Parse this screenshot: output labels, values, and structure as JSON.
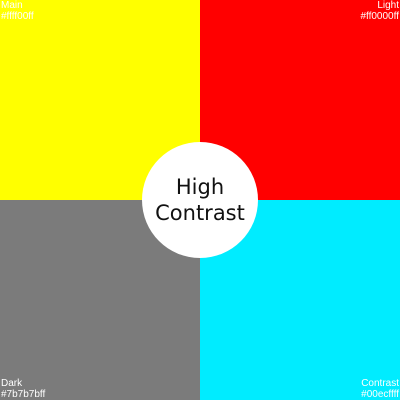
{
  "swatches": {
    "main": {
      "name": "Main",
      "code": "#ffff00ff",
      "color": "#ffff00"
    },
    "light": {
      "name": "Light",
      "code": "#ff0000ff",
      "color": "#ff0000"
    },
    "dark": {
      "name": "Dark",
      "code": "#7b7b7bff",
      "color": "#7b7b7b"
    },
    "contrast": {
      "name": "Contrast",
      "code": "#00ecffff",
      "color": "#00ecff"
    }
  },
  "center": {
    "line1": "High",
    "line2": "Contrast",
    "background": "#ffffff",
    "text_color": "#111111"
  }
}
